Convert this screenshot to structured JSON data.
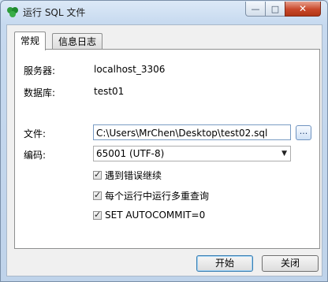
{
  "window": {
    "title": "运行 SQL 文件",
    "controls": {
      "minimize": "—",
      "maximize": "□",
      "close": "✕"
    }
  },
  "tabs": [
    {
      "label": "常规",
      "active": true
    },
    {
      "label": "信息日志",
      "active": false
    }
  ],
  "form": {
    "server_label": "服务器:",
    "server_value": "localhost_3306",
    "database_label": "数据库:",
    "database_value": "test01",
    "file_label": "文件:",
    "file_value": "C:\\Users\\MrChen\\Desktop\\test02.sql",
    "browse_label": "...",
    "encoding_label": "编码:",
    "encoding_value": "65001 (UTF-8)",
    "options": [
      {
        "label": "遇到错误继续",
        "checked": true
      },
      {
        "label": "每个运行中运行多重查询",
        "checked": true
      },
      {
        "label": "SET AUTOCOMMIT=0",
        "checked": true
      }
    ]
  },
  "buttons": {
    "start": "开始",
    "close": "关闭"
  },
  "colors": {
    "accent": "#3c7fb1",
    "close_button": "#c9482a",
    "app_icon": "#1f8a2e"
  },
  "icons": {
    "app": "leaf-logo-icon",
    "dropdown": "chevron-down-icon",
    "check": "check-icon"
  }
}
